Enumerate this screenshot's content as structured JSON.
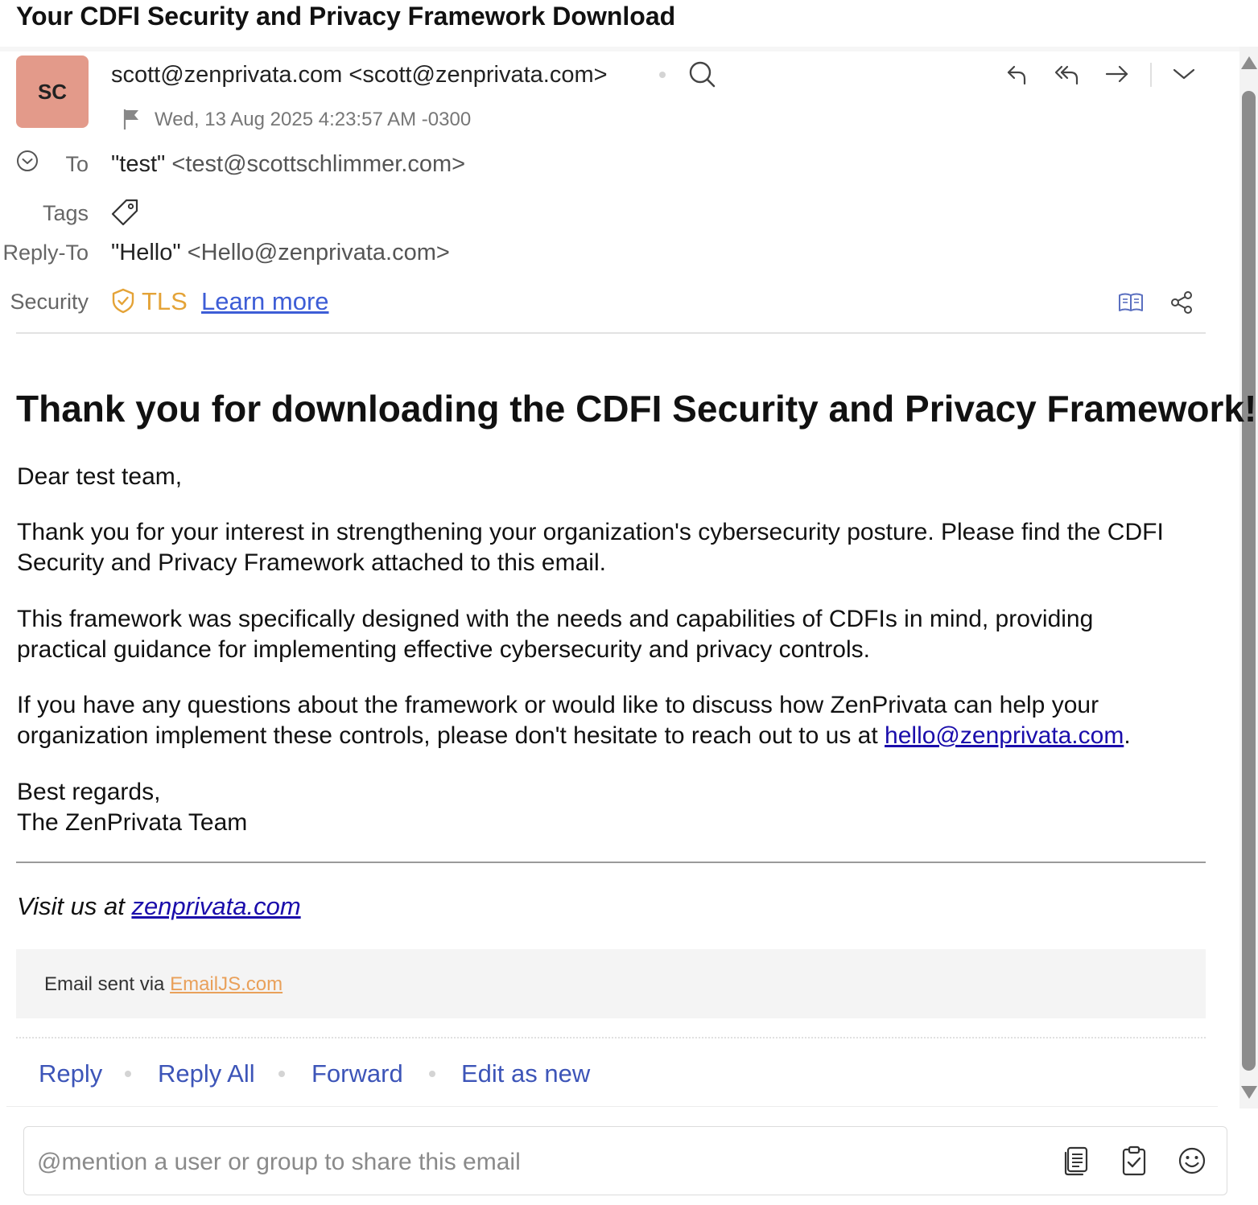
{
  "subject": "Your CDFI Security and Privacy Framework Download",
  "sender": {
    "initials": "SC",
    "from": "scott@zenprivata.com <scott@zenprivata.com>",
    "date": "Wed, 13 Aug 2025 4:23:57 AM -0300"
  },
  "header_fields": {
    "to_label": "To",
    "to_name": "\"test\"",
    "to_address": "<test@scottschlimmer.com>",
    "tags_label": "Tags",
    "reply_to_label": "Reply-To",
    "reply_to_name": "\"Hello\"",
    "reply_to_address": "<Hello@zenprivata.com>",
    "security_label": "Security",
    "security_value": "TLS",
    "learn_more": "Learn more"
  },
  "message": {
    "heading": "Thank you for downloading the CDFI Security and Privacy Framework!",
    "greeting": "Dear test team,",
    "para1": "Thank you for your interest in strengthening your organization's cybersecurity posture. Please find the CDFI Security and Privacy Framework attached to this email.",
    "para2": "This framework was specifically designed with the needs and capabilities of CDFIs in mind, providing practical guidance for implementing effective cybersecurity and privacy controls.",
    "para3_prefix": "If you have any questions about the framework or would like to discuss how ZenPrivata can help your organization implement these controls, please don't hesitate to reach out to us at ",
    "para3_link": "hello@zenprivata.com",
    "para3_suffix": ".",
    "signoff1": "Best regards,",
    "signoff2": "The ZenPrivata Team",
    "visit_prefix": "Visit us at ",
    "visit_link": "zenprivata.com",
    "sent_via_prefix": "Email sent via ",
    "sent_via_link": "EmailJS.com"
  },
  "actions": {
    "reply": "Reply",
    "reply_all": "Reply All",
    "forward": "Forward",
    "edit_as_new": "Edit as new"
  },
  "comment": {
    "placeholder": "@mention a user or group to share this email"
  },
  "colors": {
    "avatar_bg": "#e39a8a",
    "accent_link": "#3d55b8",
    "tls": "#e4a337",
    "emailjs": "#e9a05a"
  },
  "icons": {
    "toolbar": [
      "reply-icon",
      "reply-all-icon",
      "forward-icon",
      "more-chevron-icon"
    ],
    "header": [
      "search-icon",
      "flag-icon",
      "expand-details-icon",
      "tag-icon",
      "shield-check-icon",
      "reader-view-icon",
      "share-icon"
    ],
    "comment": [
      "notes-icon",
      "task-icon",
      "emoji-icon"
    ]
  }
}
